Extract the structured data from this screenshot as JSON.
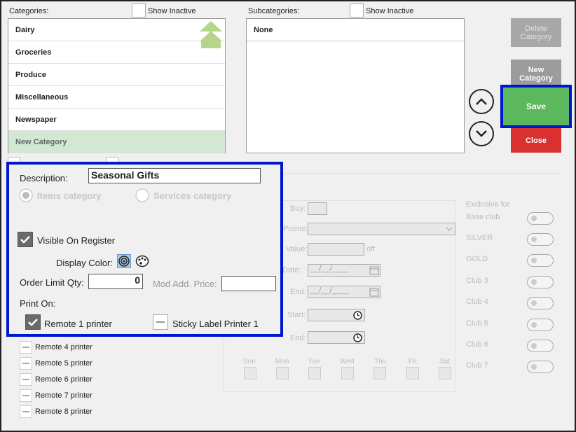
{
  "categories": {
    "label": "Categories:",
    "show_inactive": "Show Inactive",
    "items": [
      "Dairy",
      "Groceries",
      "Produce",
      "Miscellaneous",
      "Newspaper",
      "New Category"
    ]
  },
  "subcategories": {
    "label": "Subcategories:",
    "show_inactive": "Show Inactive",
    "items": [
      "None"
    ]
  },
  "buttons": {
    "delete": "Delete Category",
    "new": "New Category",
    "save": "Save",
    "close": "Close"
  },
  "form": {
    "description_label": "Description:",
    "description_value": "Seasonal Gifts",
    "items_category": "Items category",
    "services_category": "Services category",
    "visible_on_register": "Visible On Register",
    "display_color": "Display Color:",
    "order_limit_label": "Order Limit Qty:",
    "order_limit_value": "0",
    "mod_add_price": "Mod Add. Price:",
    "print_on": "Print On:",
    "printer_1": "Remote 1 printer",
    "sticky": "Sticky Label Printer 1"
  },
  "printers": [
    "Remote 4 printer",
    "Remote 5 printer",
    "Remote 6 printer",
    "Remote 7 printer",
    "Remote 8 printer"
  ],
  "promo": {
    "buy": "Buy:",
    "promo": "Promo:",
    "value": "Value:",
    "off": "off",
    "date_start": "t Date:",
    "date_end": "End:",
    "date_placeholder": "__/__/____",
    "time_start": "Start:",
    "time_end": "End:",
    "days": [
      "Sun",
      "Mon",
      "Tue",
      "Wed",
      "Thu",
      "Fri",
      "Sat"
    ]
  },
  "clubs": {
    "title": "Exclusive for",
    "items": [
      "Base club",
      "SILVER",
      "GOLD",
      "Club 3",
      "Club 4",
      "Club 5",
      "Club 6",
      "Club 7"
    ]
  },
  "colors": {
    "save": "#5cb85c",
    "close": "#d93030",
    "highlight": "#0015cf",
    "selected_row": "#d2e8d2"
  }
}
